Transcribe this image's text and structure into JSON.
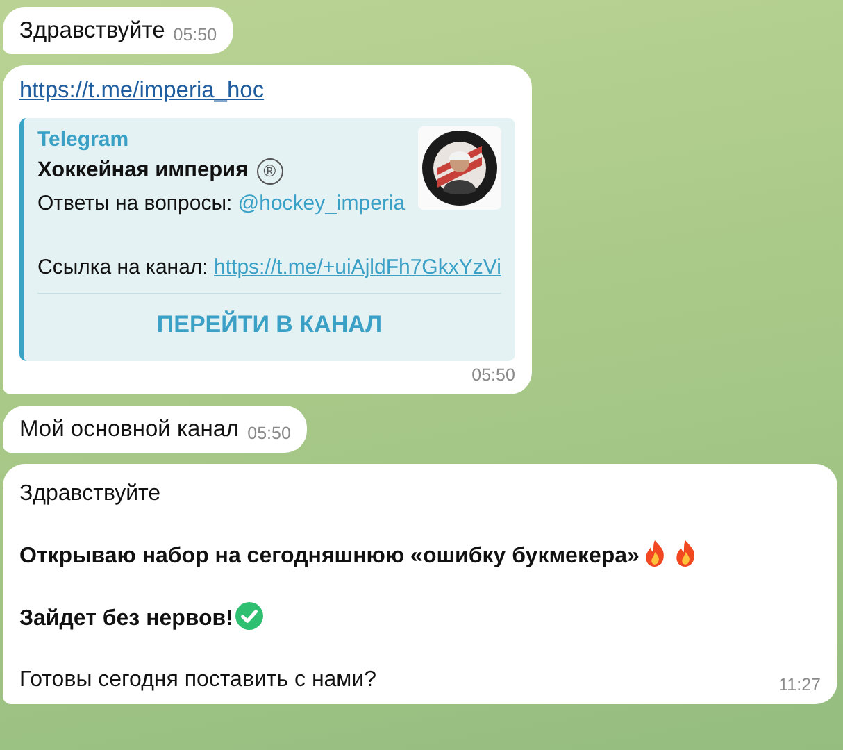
{
  "messages": [
    {
      "kind": "text",
      "text": "Здравствуйте",
      "time": "05:50"
    },
    {
      "kind": "link_preview",
      "link": "https://t.me/imperia_hoc",
      "preview": {
        "site": "Telegram",
        "title": "Хоккейная империя",
        "title_mark": "®",
        "lines": [
          {
            "label": "Ответы на вопросы: ",
            "link": "@hockey_imperia"
          },
          {
            "label": "Ссылка на канал: ",
            "link": "https://t.me/+uiAjldFh7GkxYzVi"
          }
        ],
        "button": "ПЕРЕЙТИ В КАНАЛ"
      },
      "time": "05:50"
    },
    {
      "kind": "text",
      "text": "Мой основной канал",
      "time": "05:50"
    },
    {
      "kind": "rich",
      "paragraphs": [
        {
          "text": "Здравствуйте",
          "bold": false,
          "kind": "plain"
        },
        {
          "text": "Открываю набор на сегодняшнюю «ошибку букмекера»",
          "bold": true,
          "kind": "fire"
        },
        {
          "text": "Зайдет без нервов!",
          "bold": true,
          "kind": "check"
        },
        {
          "text": "Готовы сегодня поставить с нами?",
          "bold": false,
          "kind": "plain"
        }
      ],
      "time": "11:27"
    }
  ]
}
